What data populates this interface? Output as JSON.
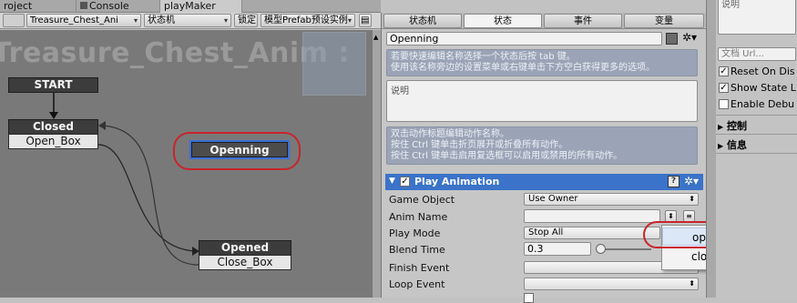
{
  "tabs": [
    {
      "label": "roject"
    },
    {
      "label": "Console"
    },
    {
      "label": "playMaker"
    }
  ],
  "toolbar": {
    "fsm_select": "Treasure_Chest_Ani",
    "state_select": "状态机",
    "lock": "锁定",
    "prefab_select": "模型Prefab预设实例"
  },
  "graph": {
    "title": "Treasure_Chest_Anim :",
    "start_label": "START",
    "states": [
      {
        "name": "Closed",
        "event": "Open_Box"
      },
      {
        "name": "Openning",
        "selected": true
      },
      {
        "name": "Opened",
        "event": "Close_Box"
      }
    ]
  },
  "inspector": {
    "tabs": [
      "状态机",
      "状态",
      "事件",
      "变量"
    ],
    "active_tab": "状态",
    "state_name": "Openning",
    "hint1_line1": "若要快速编辑名称选择一个状态后按 tab 键。",
    "hint1_line2": "使用该名称旁边的设置菜单或右键单击下方空白获得更多的选项。",
    "description_placeholder": "说明",
    "hint2_line1": "双击动作标题编辑动作名称。",
    "hint2_line2": "按住 Ctrl 键单击折页展开或折叠所有动作。",
    "hint2_line3": "按住 Ctrl 键单击启用复选框可以启用或禁用的所有动作。",
    "action": {
      "title": "Play Animation",
      "enabled": true,
      "fields": [
        {
          "label": "Game Object",
          "value": "Use Owner"
        },
        {
          "label": "Anim Name",
          "value": ""
        },
        {
          "label": "Play Mode",
          "value": "Stop All"
        },
        {
          "label": "Blend Time",
          "value": "0.3"
        },
        {
          "label": "Finish Event",
          "value": ""
        },
        {
          "label": "Loop Event",
          "value": ""
        }
      ]
    },
    "popup": [
      "opening",
      "closing"
    ]
  },
  "right_panel": {
    "top_label": "说明",
    "doc_url_placeholder": "文档 Url...",
    "checkboxes": [
      {
        "label": "Reset On Dis",
        "checked": true
      },
      {
        "label": "Show State L",
        "checked": true
      },
      {
        "label": "Enable Debu",
        "checked": false
      }
    ],
    "foldouts": [
      "控制",
      "信息"
    ]
  },
  "colors": {
    "canvas": "#797979",
    "selection": "#3b6fd8",
    "action_header": "#3a73c9",
    "highlight_oval": "#c8242b"
  }
}
